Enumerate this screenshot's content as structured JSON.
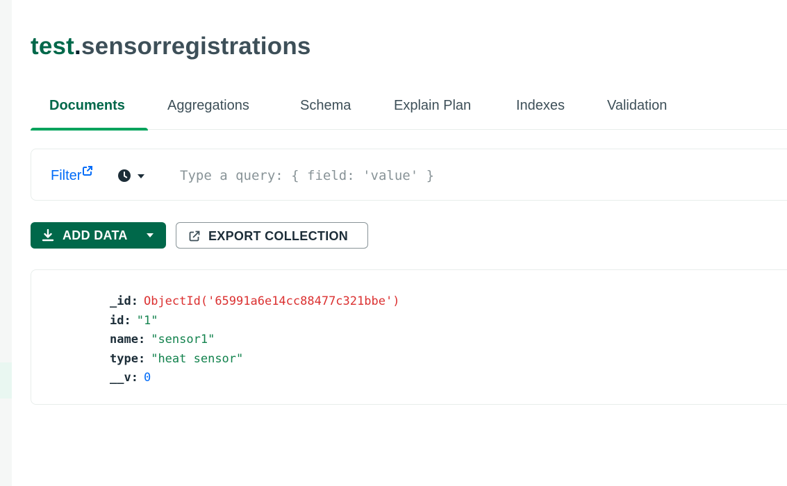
{
  "namespace": {
    "database": "test",
    "collection": "sensorregistrations"
  },
  "tabs": [
    {
      "label": "Documents",
      "active": true
    },
    {
      "label": "Aggregations",
      "active": false
    },
    {
      "label": "Schema",
      "active": false
    },
    {
      "label": "Explain Plan",
      "active": false
    },
    {
      "label": "Indexes",
      "active": false
    },
    {
      "label": "Validation",
      "active": false
    }
  ],
  "filter": {
    "label": "Filter",
    "link_icon": "external-link-icon",
    "history_icon": "clock-icon",
    "placeholder": "Type a query: { field: 'value' }"
  },
  "toolbar": {
    "add_data_label": "ADD DATA",
    "add_data_icon": "download-icon",
    "export_label": "EXPORT COLLECTION",
    "export_icon": "export-icon"
  },
  "document": {
    "fields": [
      {
        "key": "_id",
        "value": "ObjectId('65991a6e14cc88477c321bbe')",
        "kind": "oid"
      },
      {
        "key": "id",
        "value": "\"1\"",
        "kind": "str"
      },
      {
        "key": "name",
        "value": "\"sensor1\"",
        "kind": "str"
      },
      {
        "key": "type",
        "value": "\"heat sensor\"",
        "kind": "str"
      },
      {
        "key": "__v",
        "value": "0",
        "kind": "num"
      }
    ]
  },
  "colors": {
    "brand_green": "#00684a",
    "active_tab_underline": "#00a35c",
    "link_blue": "#016bf8",
    "objectid_red": "#db3030",
    "string_green": "#12824d",
    "number_blue": "#016bf8"
  }
}
